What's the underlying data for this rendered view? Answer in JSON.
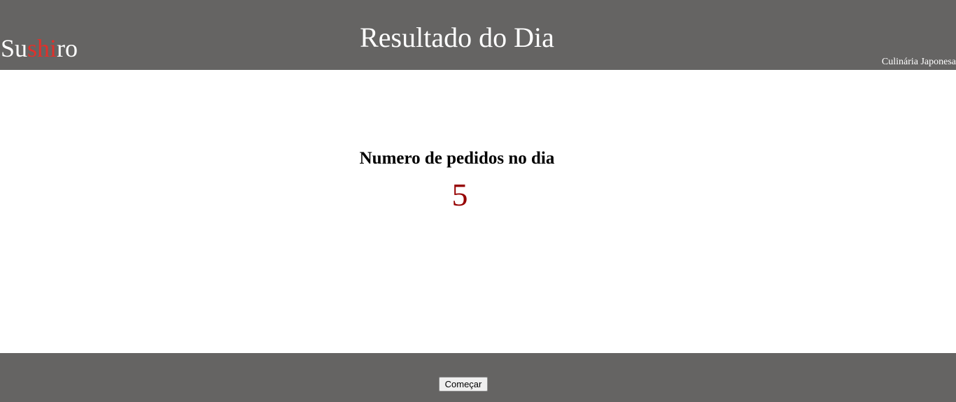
{
  "header": {
    "logo": {
      "part1": "Su",
      "part2": "shi",
      "part3": "ro",
      "accent_color": "#e2302a"
    },
    "title": "Resultado do Dia",
    "tagline": "Culinária Japonesa",
    "background_color": "#656463"
  },
  "main": {
    "orders_label": "Numero de pedidos no dia",
    "orders_count": "5",
    "count_color": "#960000"
  },
  "footer": {
    "start_button_label": "Começar",
    "background_color": "#656463"
  }
}
